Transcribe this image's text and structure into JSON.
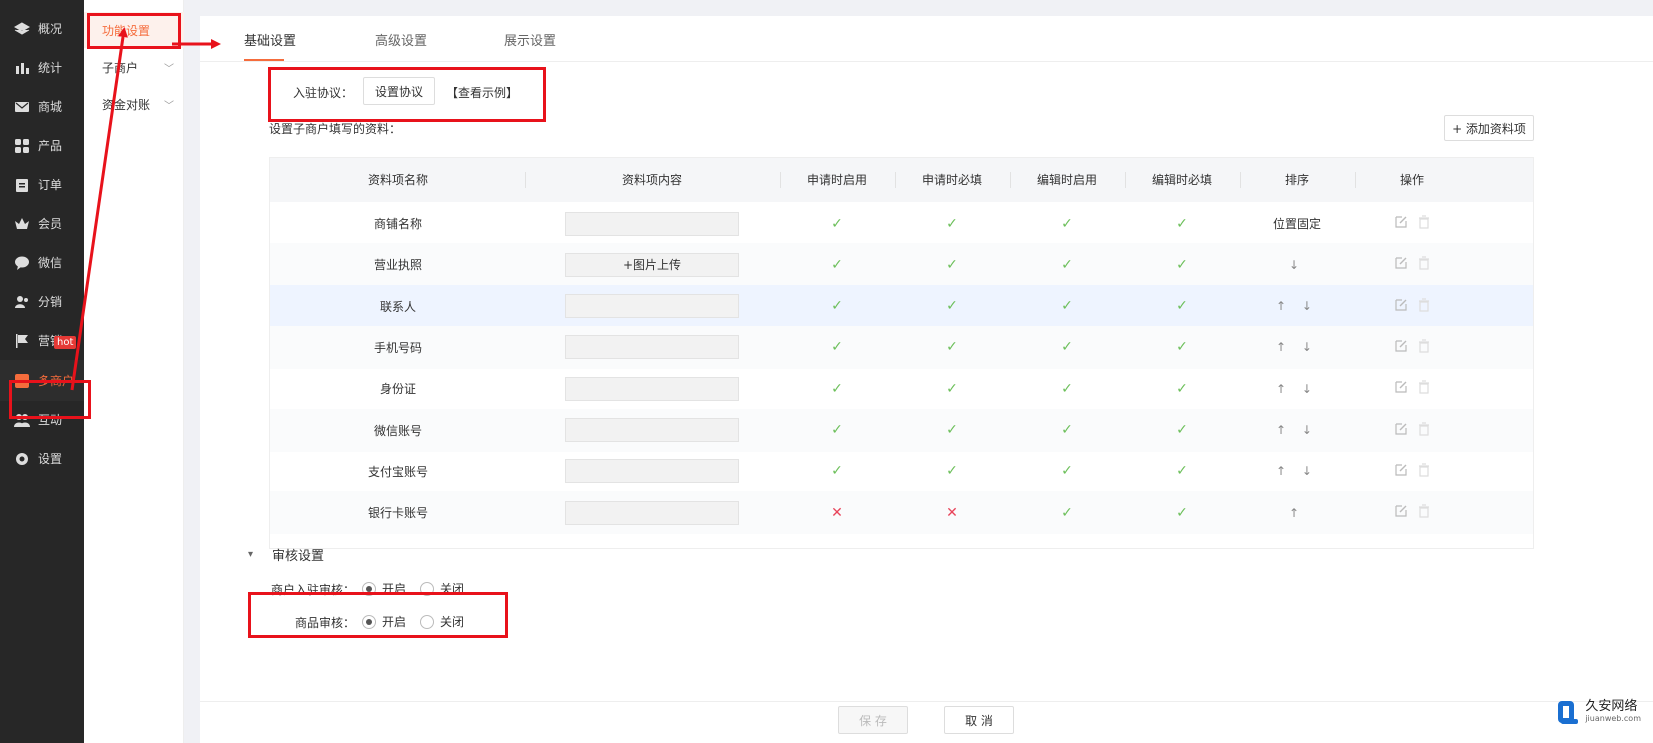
{
  "nav": {
    "items": [
      {
        "label": "概况",
        "icon": "layers-icon"
      },
      {
        "label": "统计",
        "icon": "chart-icon"
      },
      {
        "label": "商城",
        "icon": "mail-icon"
      },
      {
        "label": "产品",
        "icon": "grid-icon"
      },
      {
        "label": "订单",
        "icon": "clipboard-icon"
      },
      {
        "label": "会员",
        "icon": "crown-icon"
      },
      {
        "label": "微信",
        "icon": "chat-icon"
      },
      {
        "label": "分销",
        "icon": "users-icon"
      },
      {
        "label": "营销",
        "icon": "flag-icon"
      },
      {
        "label": "多商户",
        "icon": "store-icon"
      },
      {
        "label": "互动",
        "icon": "group-icon"
      },
      {
        "label": "设置",
        "icon": "gear-icon"
      }
    ],
    "hot_badge": "hot"
  },
  "sub": {
    "items": [
      {
        "label": "功能设置"
      },
      {
        "label": "子商户"
      },
      {
        "label": "资金对账"
      }
    ]
  },
  "tabs": [
    "基础设置",
    "高级设置",
    "展示设置"
  ],
  "agreement": {
    "label": "入驻协议：",
    "button": "设置协议",
    "example_link": "【查看示例】"
  },
  "fields_title": "设置子商户填写的资料：",
  "add_button": "+ 添加资料项",
  "table": {
    "headers": [
      "资料项名称",
      "资料项内容",
      "申请时启用",
      "申请时必填",
      "编辑时启用",
      "编辑时必填",
      "排序",
      "操作"
    ],
    "rows": [
      {
        "name": "商铺名称",
        "content": "",
        "apply_on": true,
        "apply_req": true,
        "edit_on": true,
        "edit_req": true,
        "sort": "位置固定"
      },
      {
        "name": "营业执照",
        "content": "+图片上传",
        "apply_on": true,
        "apply_req": true,
        "edit_on": true,
        "edit_req": true,
        "sort": "↓"
      },
      {
        "name": "联系人",
        "content": "",
        "apply_on": true,
        "apply_req": true,
        "edit_on": true,
        "edit_req": true,
        "sort": "↑ ↓"
      },
      {
        "name": "手机号码",
        "content": "",
        "apply_on": true,
        "apply_req": true,
        "edit_on": true,
        "edit_req": true,
        "sort": "↑ ↓"
      },
      {
        "name": "身份证",
        "content": "",
        "apply_on": true,
        "apply_req": true,
        "edit_on": true,
        "edit_req": true,
        "sort": "↑ ↓"
      },
      {
        "name": "微信账号",
        "content": "",
        "apply_on": true,
        "apply_req": true,
        "edit_on": true,
        "edit_req": true,
        "sort": "↑ ↓"
      },
      {
        "name": "支付宝账号",
        "content": "",
        "apply_on": true,
        "apply_req": true,
        "edit_on": true,
        "edit_req": true,
        "sort": "↑ ↓"
      },
      {
        "name": "银行卡账号",
        "content": "",
        "apply_on": false,
        "apply_req": false,
        "edit_on": true,
        "edit_req": true,
        "sort": "↑"
      }
    ],
    "check_glyph": "✓",
    "cross_glyph": "✕"
  },
  "audit": {
    "section_title": "审核设置",
    "collapse_glyph": "▾",
    "merchant_label": "商户入驻审核：",
    "product_label": "商品审核：",
    "open": "开启",
    "close": "关闭"
  },
  "footer": {
    "save": "保 存",
    "cancel": "取 消"
  },
  "watermark": {
    "name": "久安网络",
    "url": "jiuanweb.com"
  },
  "colors": {
    "accent": "#f56c3c",
    "check": "#6cbf5a",
    "cross": "#e8445a",
    "annotation": "#e8121b"
  }
}
